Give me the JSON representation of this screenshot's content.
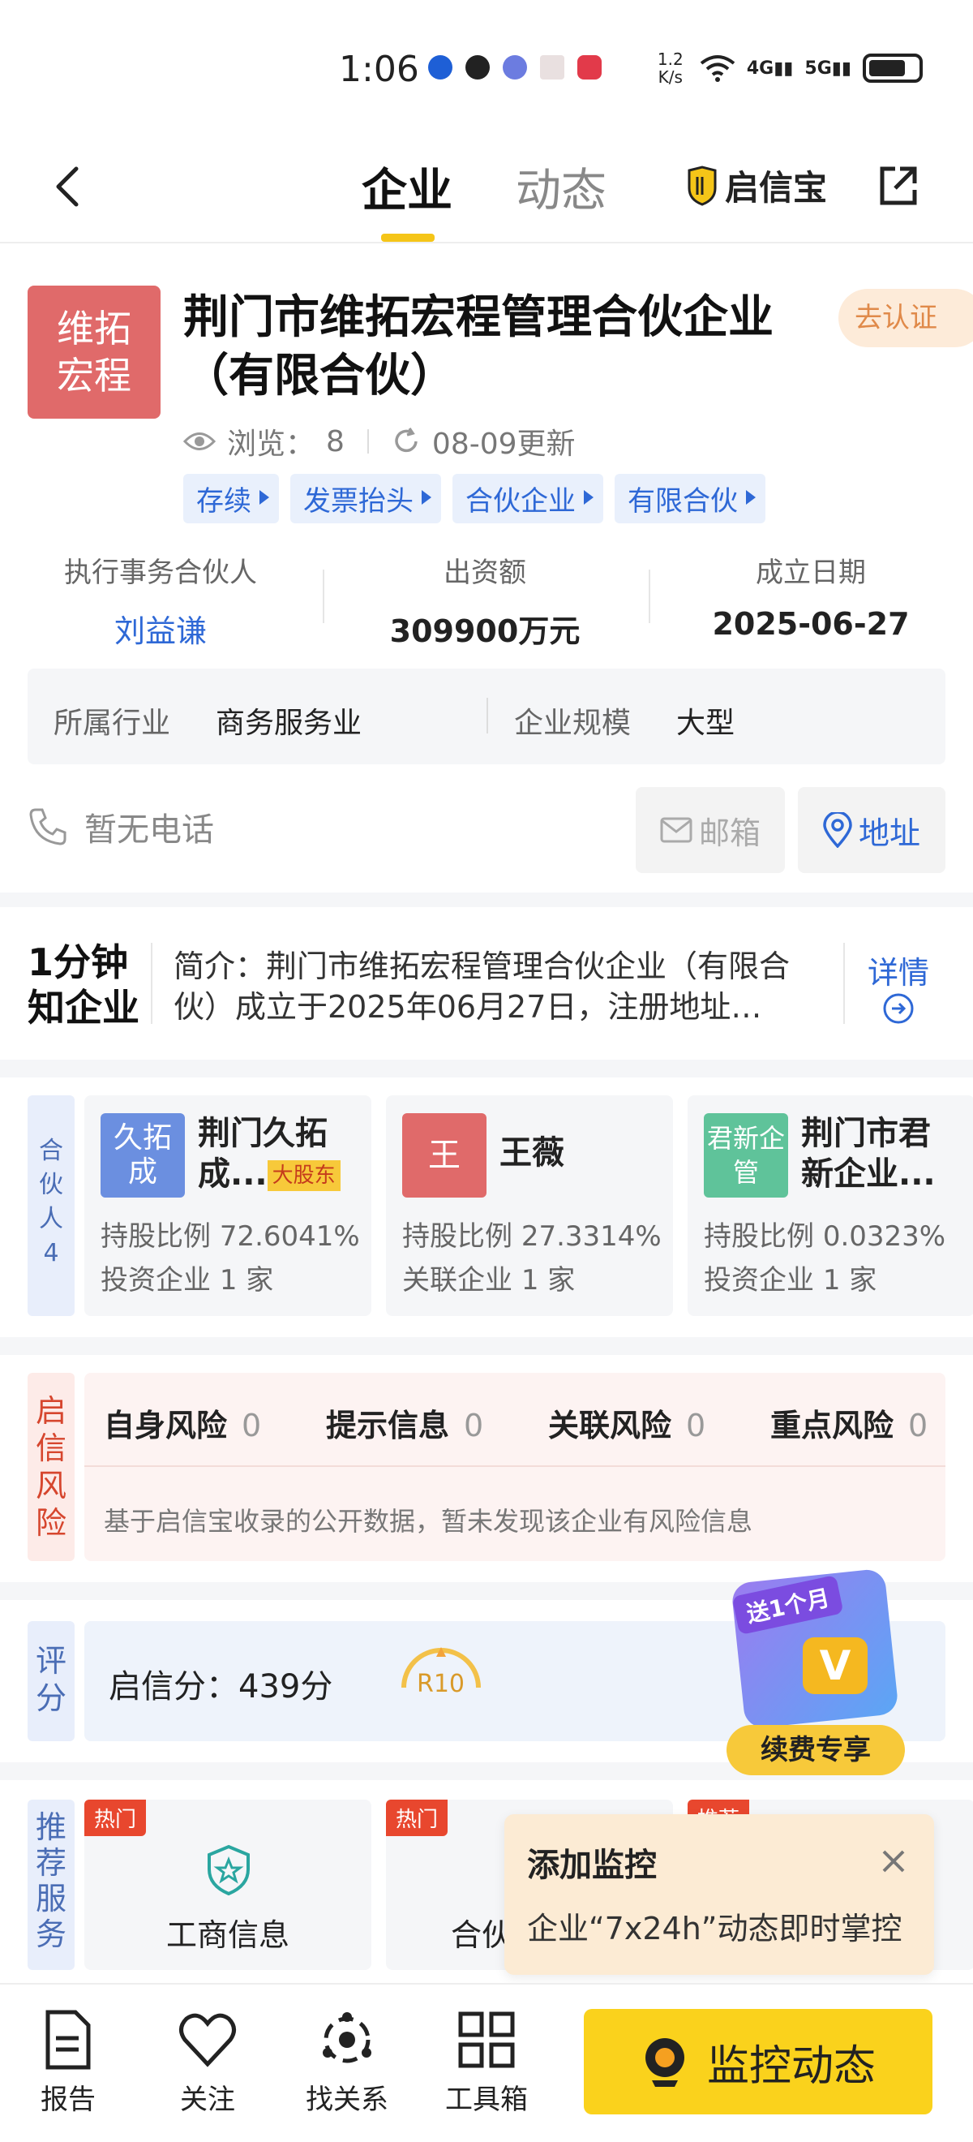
{
  "status": {
    "time": "1:06",
    "speed": "1.2 K/s",
    "net1": "4G",
    "net2": "5G"
  },
  "nav": {
    "tab_company": "企业",
    "tab_news": "动态",
    "brand": "启信宝"
  },
  "company": {
    "logo_text_line1": "维拓",
    "logo_text_line2": "宏程",
    "name": "荆门市维拓宏程管理合伙企业（有限合伙）",
    "verify": "去认证",
    "views_label": "浏览：",
    "views": "8",
    "updated": "08-09更新",
    "tags": [
      "存续",
      "发票抬头",
      "合伙企业",
      "有限合伙"
    ],
    "stats": [
      {
        "label": "执行事务合伙人",
        "value": "刘益谦"
      },
      {
        "label": "出资额",
        "value": "309900万元"
      },
      {
        "label": "成立日期",
        "value": "2025-06-27"
      }
    ],
    "industry_label": "所属行业",
    "industry": "商务服务业",
    "scale_label": "企业规模",
    "scale": "大型",
    "phone": "暂无电话",
    "email_btn": "邮箱",
    "address_btn": "地址"
  },
  "intro": {
    "badge_line1": "1分钟",
    "badge_line2": "知企业",
    "text": "简介：荆门市维拓宏程管理合伙企业（有限合伙）成立于2025年06月27日，注册地址…",
    "more": "详情"
  },
  "partners": {
    "side_label": "合伙人4",
    "items": [
      {
        "logo": "久拓成",
        "name": "荆门久拓成...",
        "tag": "大股东",
        "ratio_label": "持股比例",
        "ratio": "72.6041%",
        "sub_label": "投资企业",
        "sub_value": "1 家",
        "color": "#6b8fe0"
      },
      {
        "logo": "王",
        "name": "王薇",
        "tag": "",
        "ratio_label": "持股比例",
        "ratio": "27.3314%",
        "sub_label": "关联企业",
        "sub_value": "1 家",
        "color": "#e06a6a"
      },
      {
        "logo": "君新企管",
        "name": "荆门市君新企业...",
        "tag": "",
        "ratio_label": "持股比例",
        "ratio": "0.0323%",
        "sub_label": "投资企业",
        "sub_value": "1 家",
        "color": "#5fc39a"
      }
    ]
  },
  "risk": {
    "side_label": "启信风险",
    "items": [
      {
        "label": "自身风险",
        "count": "0"
      },
      {
        "label": "提示信息",
        "count": "0"
      },
      {
        "label": "关联风险",
        "count": "0"
      },
      {
        "label": "重点风险",
        "count": "0"
      }
    ],
    "note": "基于启信宝收录的公开数据，暂未发现该企业有风险信息"
  },
  "score": {
    "side_label": "评分",
    "text": "启信分：439分",
    "badge": "R10"
  },
  "promo": {
    "title": "送1个月",
    "button": "续费专享"
  },
  "services": {
    "side_label": "推荐服务",
    "items": [
      {
        "hot": "热门",
        "label": "工商信息"
      },
      {
        "hot": "热门",
        "label": "合伙"
      },
      {
        "hot": "推荐",
        "label": ""
      }
    ]
  },
  "popup": {
    "title": "添加监控",
    "text": "企业“7x24h”动态即时掌控"
  },
  "bottom": {
    "items": [
      "报告",
      "关注",
      "找关系",
      "工具箱"
    ],
    "monitor": "监控动态"
  }
}
